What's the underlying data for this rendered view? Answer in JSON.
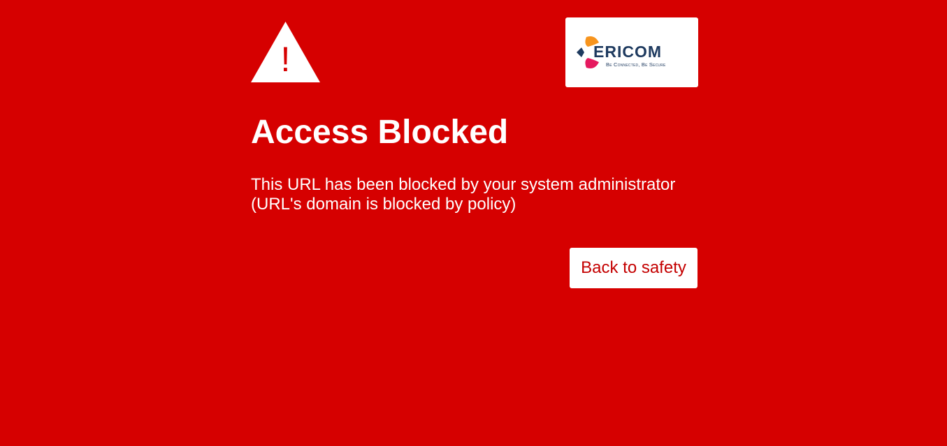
{
  "page": {
    "title": "Access Blocked",
    "background_color": "#d60000",
    "warning_icon": "warning-triangle-icon"
  },
  "logo": {
    "name": "ERICOM",
    "tagline": "Be Connected, Be Secure",
    "mark_colors": [
      "#f7941d",
      "#e6195f",
      "#1e3a5f"
    ]
  },
  "message": {
    "line1": "This URL has been blocked by your system administrator",
    "line2": "(URL's domain is blocked by policy)"
  },
  "actions": {
    "back_label": "Back to safety",
    "back_text_color": "#c40000"
  }
}
